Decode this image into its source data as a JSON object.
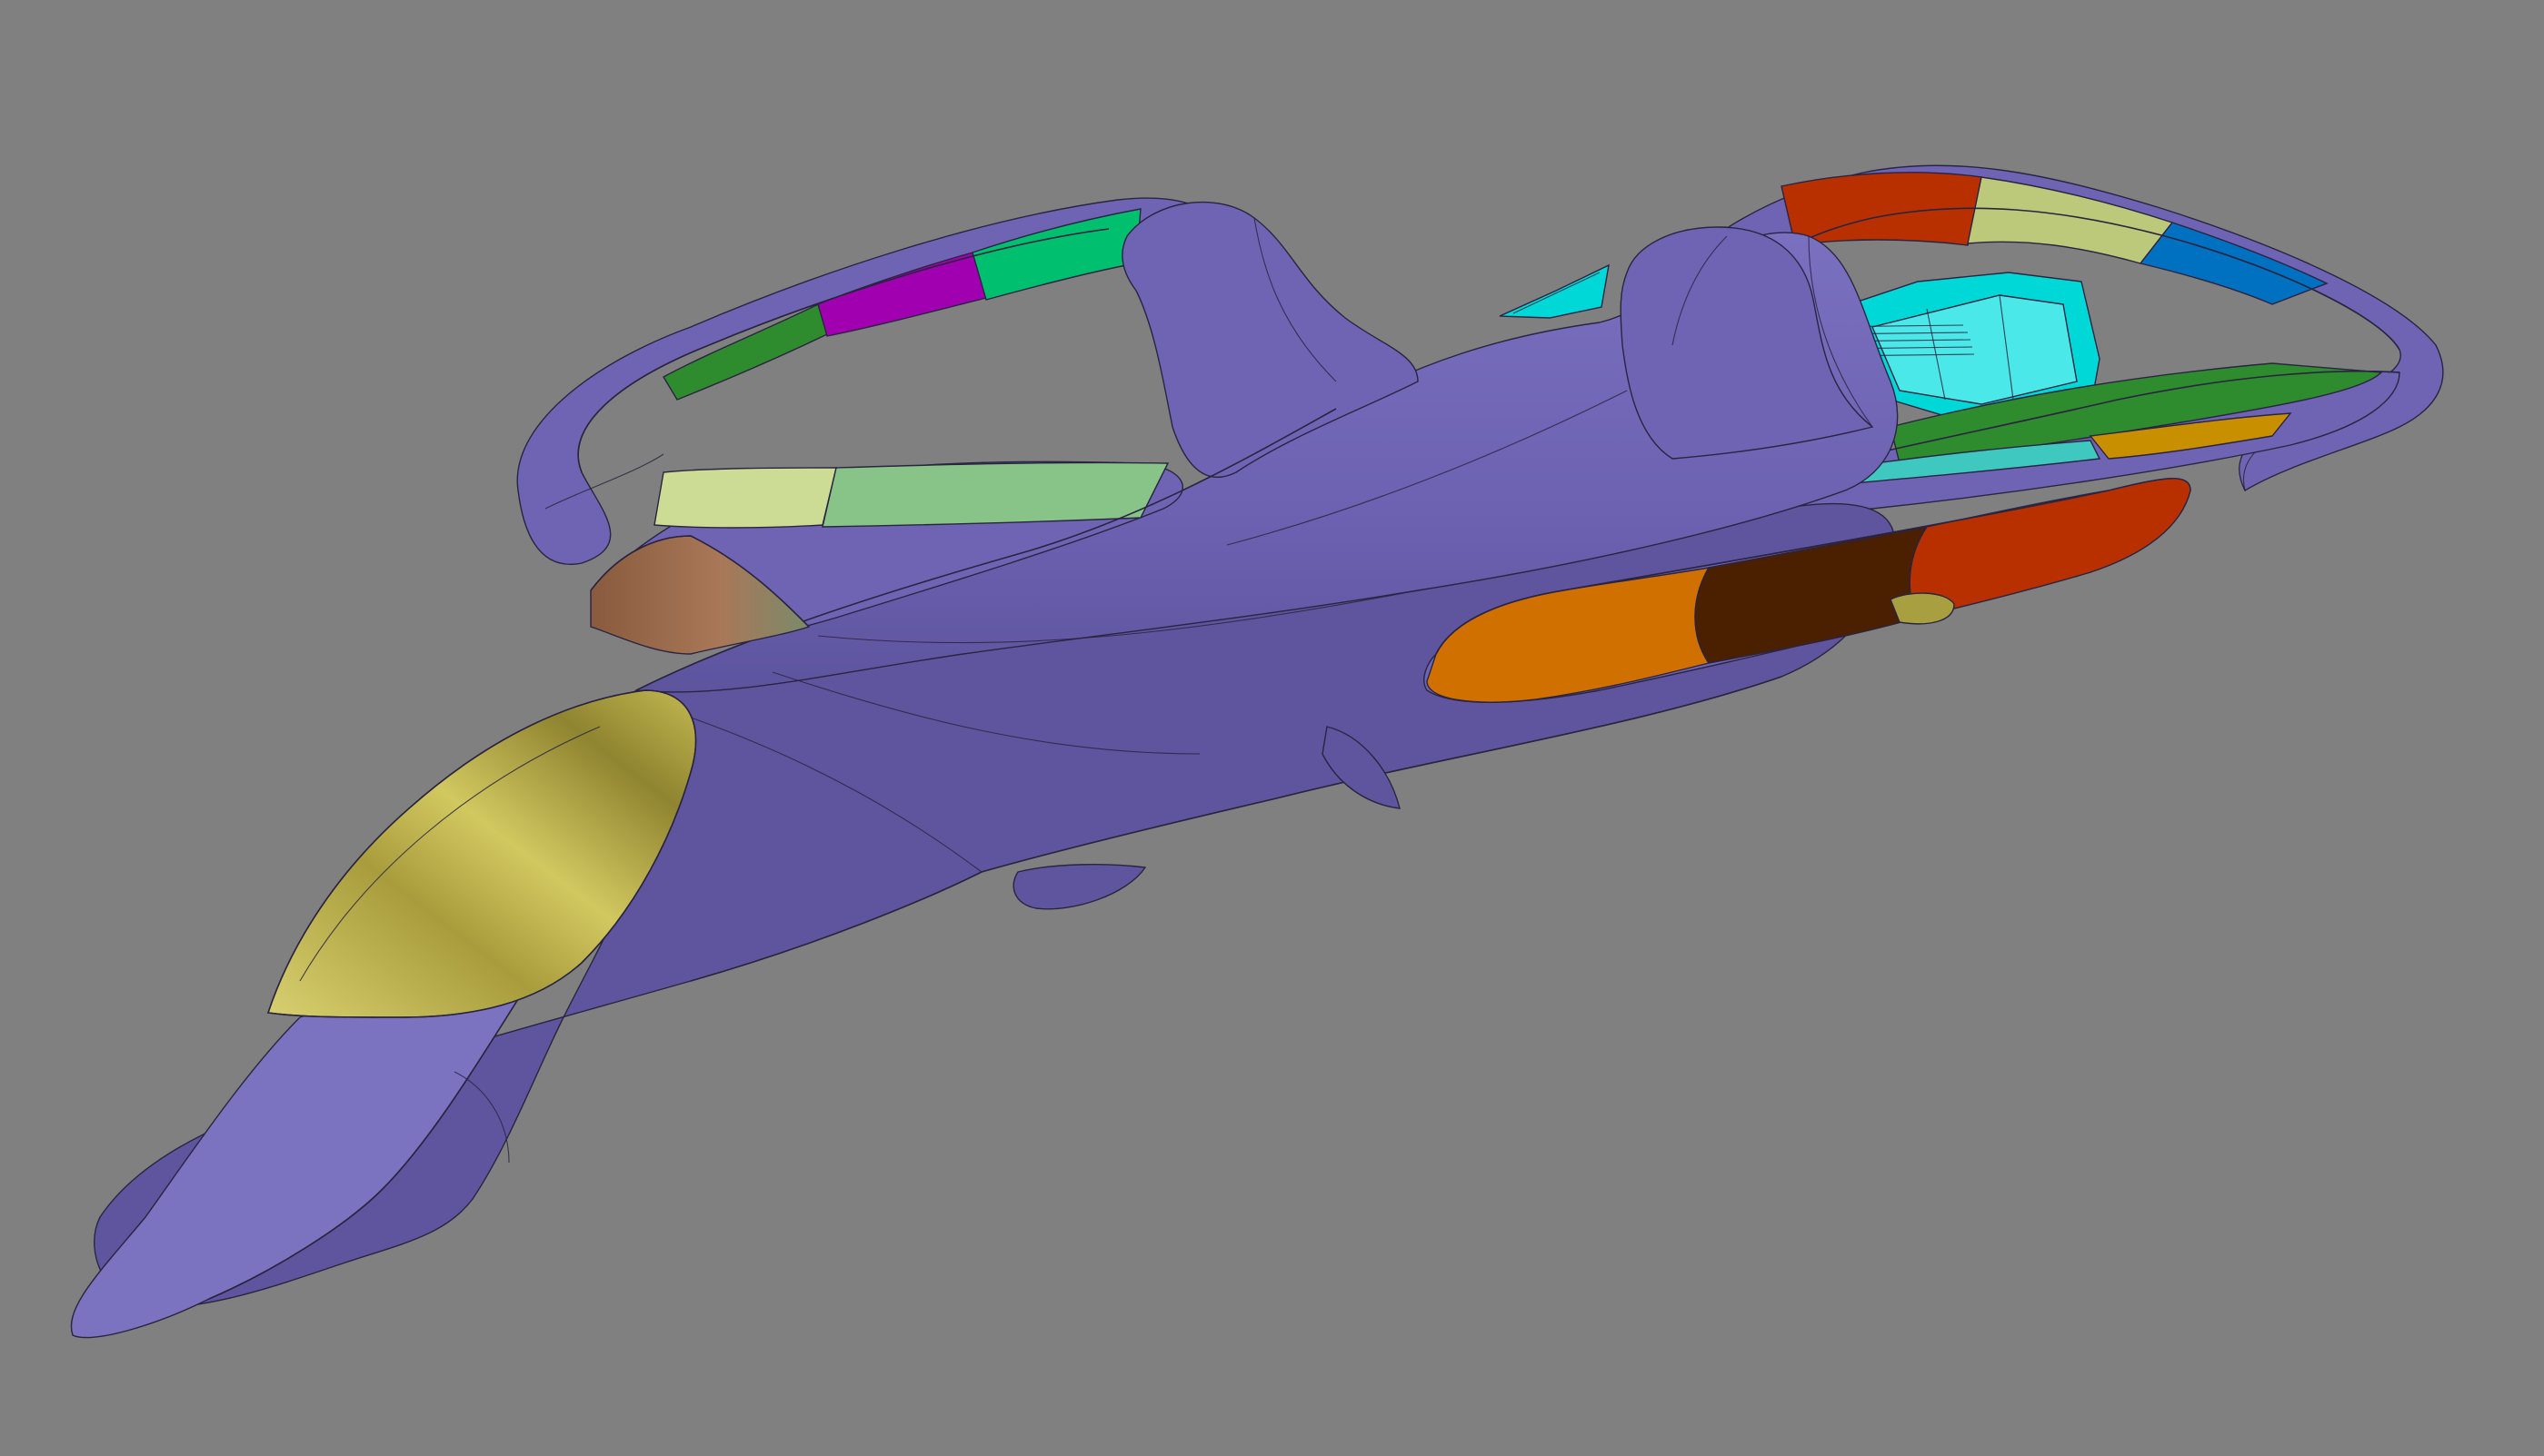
{
  "viewport": {
    "background": "#808080"
  },
  "model": {
    "body_color": "#6f64b4",
    "body_shade": "#5f559f",
    "body_highlight": "#7b72c0",
    "edge_color": "#2a2440",
    "canopy_color": "#b8ae52",
    "left_ring_segments": [
      {
        "name": "dark-green",
        "color": "#2e8b2e"
      },
      {
        "name": "magenta",
        "color": "#a000b0"
      },
      {
        "name": "teal-green",
        "color": "#00c070"
      }
    ],
    "right_ring_segments": [
      {
        "name": "red",
        "color": "#b83000"
      },
      {
        "name": "pale-yellow-green",
        "color": "#bcc87a"
      },
      {
        "name": "blue",
        "color": "#0070c0"
      }
    ],
    "left_wing_panels": [
      {
        "name": "pale-yellow",
        "color": "#ccdc94"
      },
      {
        "name": "light-green",
        "color": "#88c488"
      }
    ],
    "right_wing_panels": [
      {
        "name": "green",
        "color": "#2e8b2e"
      },
      {
        "name": "gold",
        "color": "#c89000"
      }
    ],
    "side_pod_segments": [
      {
        "name": "orange",
        "color": "#d07000"
      },
      {
        "name": "dark-brown",
        "color": "#4a2000"
      },
      {
        "name": "red",
        "color": "#b83000"
      }
    ],
    "engine_color": "#00d8d8",
    "intake_brown": "#9a6a4a"
  }
}
